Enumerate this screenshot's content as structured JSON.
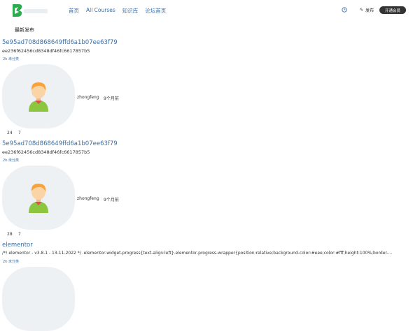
{
  "header": {
    "nav": [
      "首页",
      "All Courses",
      "知识库",
      "论坛首页"
    ],
    "publish_label": "发布",
    "open_label": "开通会员"
  },
  "section_title": "最新发布",
  "posts": [
    {
      "title": "5e95ad708d868649ffd6a1b07ee63f79",
      "excerpt": "ee236f62456cd8348df46fc6617857b5",
      "category": "2h·未分类",
      "author": "zhongfeng",
      "time": "9个月前",
      "views": "24",
      "comments": "7"
    },
    {
      "title": "5e95ad708d868649ffd6a1b07ee63f79",
      "excerpt": "ee236f62456cd8348df46fc6617857b5",
      "category": "2h·未分类",
      "author": "zhongfeng",
      "time": "9个月前",
      "views": "28",
      "comments": "7"
    },
    {
      "title": "elementor",
      "excerpt": "/*! elementor - v3.8.1 - 13-11-2022 */ .elementor-widget-progress{text-align:left}.elementor-progress-wrapper{position:relative;background-color:#eee;color:#fff;height:100%;border-...",
      "category": "2h·未分类"
    }
  ],
  "colors": {
    "link": "#3a6ea5",
    "avatar_bg": "#eef1f4",
    "brand": "#2eaa4f"
  }
}
